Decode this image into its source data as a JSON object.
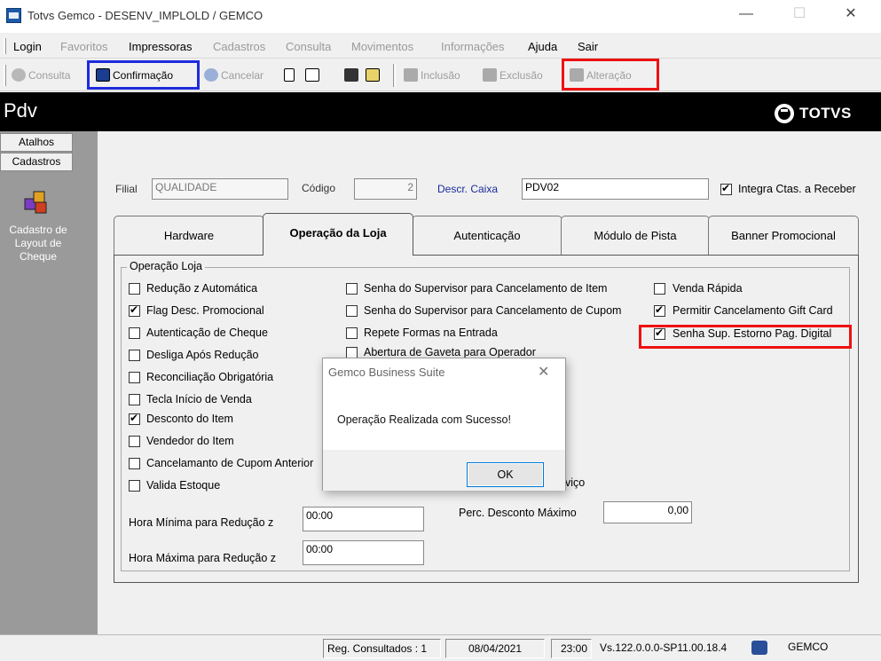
{
  "window": {
    "title": "Totvs Gemco - DESENV_IMPLOLD / GEMCO",
    "minimize": "—",
    "maximize": "☐",
    "close": "✕"
  },
  "menu": [
    {
      "label": "Login",
      "enabled": true
    },
    {
      "label": "Favoritos",
      "enabled": false
    },
    {
      "label": "Impressoras",
      "enabled": true
    },
    {
      "label": "Cadastros",
      "enabled": false
    },
    {
      "label": "Consulta",
      "enabled": false
    },
    {
      "label": "Movimentos",
      "enabled": false
    },
    {
      "label": "Informações",
      "enabled": false
    },
    {
      "label": "Ajuda",
      "enabled": true
    },
    {
      "label": "Sair",
      "enabled": true
    }
  ],
  "toolbar": {
    "consulta": "Consulta",
    "confirmacao": "Confirmação",
    "cancelar": "Cancelar",
    "inclusao": "Inclusão",
    "exclusao": "Exclusão",
    "alteracao": "Alteração"
  },
  "header": {
    "title": "Pdv",
    "logo": "TOTVS"
  },
  "left_panel": {
    "atalhos": "Atalhos",
    "cadastros": "Cadastros",
    "item_label": "Cadastro de Layout de Cheque",
    "item_icon": "puzzle-icon"
  },
  "form": {
    "filial_label": "Filial",
    "filial_value": "QUALIDADE",
    "codigo_label": "Código",
    "codigo_value": "2",
    "descr_caixa_label": "Descr. Caixa",
    "descr_caixa_value": "PDV02",
    "integra_label": "Integra Ctas. a Receber",
    "integra_checked": true
  },
  "tabs": [
    {
      "label": "Hardware",
      "active": false
    },
    {
      "label": "Operação da Loja",
      "active": true
    },
    {
      "label": "Autenticação",
      "active": false
    },
    {
      "label": "Módulo de Pista",
      "active": false
    },
    {
      "label": "Banner Promocional",
      "active": false
    }
  ],
  "group": {
    "title": "Operação Loja",
    "col1": [
      {
        "label": "Redução z Automática",
        "checked": false
      },
      {
        "label": "Flag Desc. Promocional",
        "checked": true
      },
      {
        "label": "Autenticação de Cheque",
        "checked": false
      },
      {
        "label": "Desliga Após Redução",
        "checked": false
      },
      {
        "label": "Reconciliação Obrigatória",
        "checked": false
      },
      {
        "label": "Tecla Início de Venda",
        "checked": false
      },
      {
        "label": "Desconto do Item",
        "checked": true
      },
      {
        "label": "Vendedor do Item",
        "checked": false
      },
      {
        "label": "Cancelamanto de Cupom Anterior",
        "checked": false
      },
      {
        "label": "Valida Estoque",
        "checked": false
      }
    ],
    "col2": [
      {
        "label": "Senha do Supervisor para Cancelamento de Item",
        "checked": false
      },
      {
        "label": "Senha do Supervisor para Cancelamento de Cupom",
        "checked": false
      },
      {
        "label": "Repete Formas na Entrada",
        "checked": false
      },
      {
        "label": "Abertura de Gaveta para Operador",
        "checked": false
      }
    ],
    "col2_partial": "viço",
    "col3": [
      {
        "label": "Venda Rápida",
        "checked": false
      },
      {
        "label": "Permitir Cancelamento Gift Card",
        "checked": true
      },
      {
        "label": "Senha Sup. Estorno Pag. Digital",
        "checked": true
      }
    ],
    "hora_min_label": "Hora Mínima para Redução z",
    "hora_min_value": "00:00",
    "hora_max_label": "Hora Máxima para Redução z",
    "hora_max_value": "00:00",
    "perc_label": "Perc. Desconto Máximo",
    "perc_value": "0,00"
  },
  "status": {
    "reg": "Reg. Consultados : 1",
    "date": "08/04/2021",
    "time": "23:00",
    "version": "Vs.122.0.0.0-SP11.00.18.4",
    "user": "GEMCO"
  },
  "dialog": {
    "title": "Gemco Business Suite",
    "close": "✕",
    "message": "Operação Realizada com Sucesso!",
    "ok": "OK"
  },
  "highlight_colors": {
    "blue": "#1e2bdc",
    "red": "#ee1111"
  }
}
